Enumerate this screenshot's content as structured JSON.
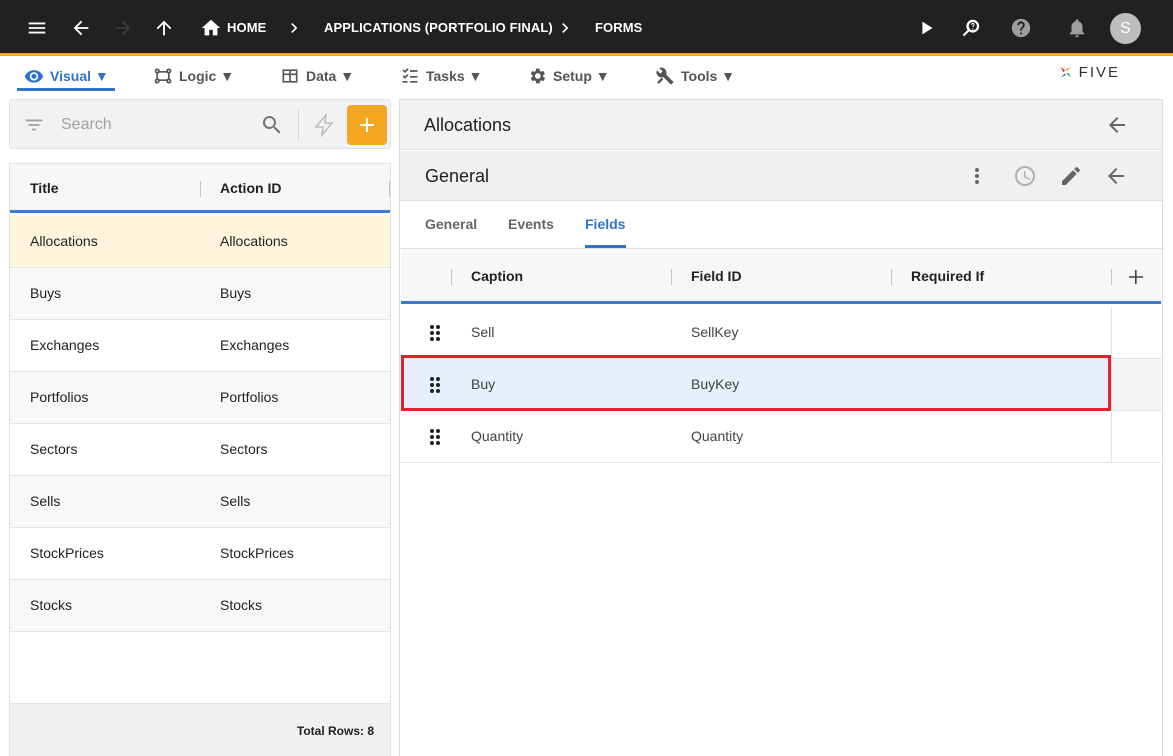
{
  "topbar": {
    "home_label": "HOME",
    "app_label": "APPLICATIONS (PORTFOLIO FINAL)",
    "forms_label": "FORMS",
    "avatar_initial": "S",
    "icons": [
      "menu-icon",
      "back-arrow-icon",
      "forward-arrow-icon",
      "up-arrow-icon",
      "home-icon",
      "play-icon",
      "search-help-icon",
      "help-icon",
      "bell-icon"
    ]
  },
  "menubar": {
    "items": [
      {
        "label": "Visual ▼",
        "icon": "eye-icon",
        "active": true
      },
      {
        "label": "Logic ▼",
        "icon": "logic-icon"
      },
      {
        "label": "Data ▼",
        "icon": "table-icon"
      },
      {
        "label": "Tasks ▼",
        "icon": "checklist-icon"
      },
      {
        "label": "Setup ▼",
        "icon": "gear-icon"
      },
      {
        "label": "Tools ▼",
        "icon": "tools-icon"
      }
    ],
    "logo_text": "FIVE"
  },
  "left": {
    "search_placeholder": "Search",
    "columns": [
      "Title",
      "Action ID"
    ],
    "rows": [
      {
        "title": "Allocations",
        "action_id": "Allocations",
        "selected": true
      },
      {
        "title": "Buys",
        "action_id": "Buys"
      },
      {
        "title": "Exchanges",
        "action_id": "Exchanges"
      },
      {
        "title": "Portfolios",
        "action_id": "Portfolios"
      },
      {
        "title": "Sectors",
        "action_id": "Sectors"
      },
      {
        "title": "Sells",
        "action_id": "Sells"
      },
      {
        "title": "StockPrices",
        "action_id": "StockPrices"
      },
      {
        "title": "Stocks",
        "action_id": "Stocks"
      }
    ],
    "total_rows": "Total Rows: 8"
  },
  "right": {
    "title": "Allocations",
    "section_title": "General",
    "tabs": [
      {
        "label": "General"
      },
      {
        "label": "Events"
      },
      {
        "label": "Fields",
        "active": true
      }
    ],
    "columns": [
      "Caption",
      "Field ID",
      "Required If"
    ],
    "rows": [
      {
        "caption": "Sell",
        "field_id": "SellKey",
        "required_if": ""
      },
      {
        "caption": "Buy",
        "field_id": "BuyKey",
        "required_if": "",
        "highlighted": true
      },
      {
        "caption": "Quantity",
        "field_id": "Quantity",
        "required_if": ""
      }
    ]
  },
  "colors": {
    "topbar_bg": "#212121",
    "accent_orange": "#f5a623",
    "accent_blue": "#2e74c9",
    "selected_row": "#fff5dc",
    "highlight_red": "#e5202a"
  }
}
